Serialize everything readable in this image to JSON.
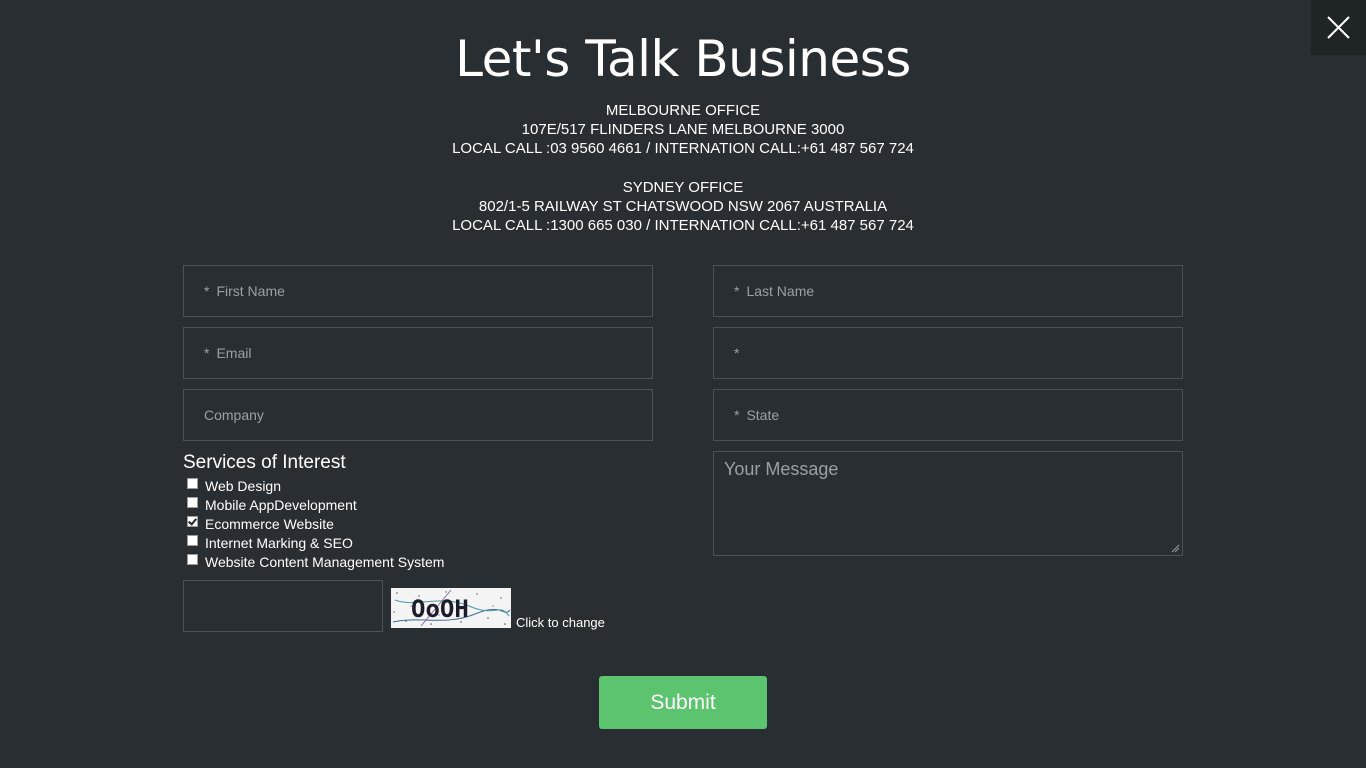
{
  "title": "Let's Talk Business",
  "offices": [
    {
      "name": "MELBOURNE OFFICE",
      "address": "107E/517 FLINDERS LANE MELBOURNE 3000",
      "phones": "LOCAL CALL :03 9560 4661 / INTERNATION CALL:+61 487 567 724"
    },
    {
      "name": "SYDNEY OFFICE",
      "address": "802/1-5 RAILWAY ST CHATSWOOD NSW 2067 AUSTRALIA",
      "phones": "LOCAL CALL :1300 665 030 / INTERNATION CALL:+61 487 567 724"
    }
  ],
  "form": {
    "required_mark": "*",
    "first_name": "First Name",
    "last_name": "Last Name",
    "email": "Email",
    "unlabeled": "",
    "company": "Company",
    "state": "State",
    "message_placeholder": "Your Message",
    "services_title": "Services of Interest",
    "services": [
      {
        "label": "Web Design",
        "checked": false
      },
      {
        "label": "Mobile AppDevelopment",
        "checked": false
      },
      {
        "label": "Ecommerce Website",
        "checked": true
      },
      {
        "label": "Internet Marking & SEO",
        "checked": false
      },
      {
        "label": "Website Content Management System",
        "checked": false
      }
    ],
    "captcha_text": "OoOH",
    "captcha_change": "Click to change",
    "submit": "Submit"
  },
  "colors": {
    "background": "#282e32",
    "field_border": "#4a5358",
    "submit": "#5cc36f"
  }
}
